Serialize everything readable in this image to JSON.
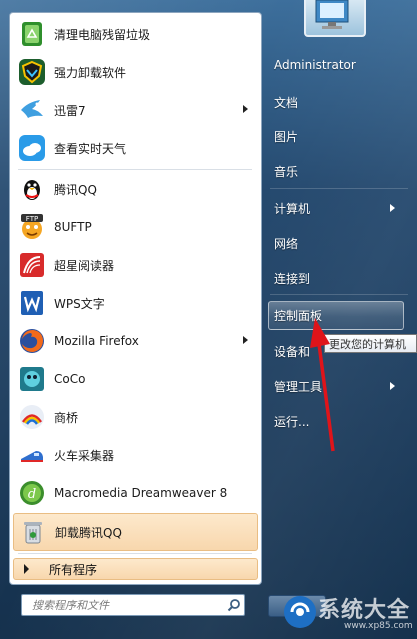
{
  "programs": [
    {
      "label": "清理电脑残留垃圾",
      "icon": "recycle-icon"
    },
    {
      "label": "强力卸载软件",
      "icon": "shield-uninstall-icon"
    },
    {
      "label": "迅雷7",
      "icon": "thunder-bird-icon"
    },
    {
      "label": "查看实时天气",
      "icon": "weather-cloud-icon"
    },
    {
      "label": "腾讯QQ",
      "icon": "qq-penguin-icon"
    },
    {
      "label": "8UFTP",
      "icon": "ftp-face-icon"
    },
    {
      "label": "超星阅读器",
      "icon": "ssreader-icon"
    },
    {
      "label": "WPS文字",
      "icon": "wps-writer-icon"
    },
    {
      "label": "Mozilla Firefox",
      "icon": "firefox-icon"
    },
    {
      "label": "CoCo",
      "icon": "coco-icon"
    },
    {
      "label": "商桥",
      "icon": "rainbow-bridge-icon"
    },
    {
      "label": "火车采集器",
      "icon": "train-icon"
    },
    {
      "label": "Macromedia Dreamweaver 8",
      "icon": "dreamweaver-icon"
    },
    {
      "label": "卸载腾讯QQ",
      "icon": "trash-bin-icon"
    }
  ],
  "all_programs_label": "所有程序",
  "search_placeholder": "搜索程序和文件",
  "right_pane": {
    "username": "Administrator",
    "documents": "文档",
    "pictures": "图片",
    "music": "音乐",
    "computer": "计算机",
    "network": "网络",
    "connect_to": "连接到",
    "control_panel": "控制面板",
    "devices_printers": "设备和",
    "admin_tools": "管理工具",
    "run": "运行..."
  },
  "tooltip": "更改您的计算机",
  "watermark": {
    "text": "系统大全",
    "url": "www.xp85.com"
  },
  "colors": {
    "highlight": "#f8d7ad",
    "annotation_arrow": "#e0141a",
    "frame": "#21466c"
  }
}
